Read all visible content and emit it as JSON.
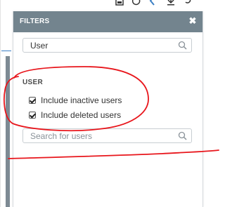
{
  "app_toolbar": {
    "icons": [
      "save-icon",
      "refresh-icon",
      "back-icon",
      "download-icon",
      "undo-icon"
    ]
  },
  "filters": {
    "title": "FILTERS",
    "close_symbol": "✖",
    "top_search": {
      "value": "User",
      "placeholder": ""
    },
    "user_section": {
      "label": "USER",
      "options": [
        {
          "label": "Include inactive users",
          "checked": true
        },
        {
          "label": "Include deleted users",
          "checked": true
        }
      ],
      "search": {
        "value": "",
        "placeholder": "Search for users"
      }
    }
  },
  "colors": {
    "header_bg": "#73848e",
    "annotation": "#e8161c"
  }
}
